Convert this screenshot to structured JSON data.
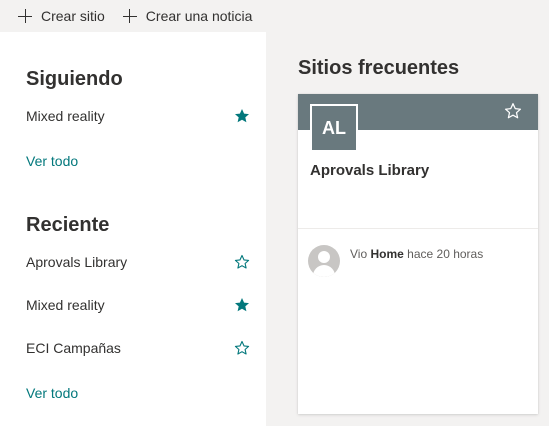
{
  "command_bar": {
    "create_site_label": "Crear sitio",
    "create_news_label": "Crear una noticia"
  },
  "following": {
    "title": "Siguiendo",
    "items": [
      {
        "label": "Mixed reality",
        "starred": true
      }
    ],
    "see_all_label": "Ver todo"
  },
  "recent": {
    "title": "Reciente",
    "items": [
      {
        "label": "Aprovals Library",
        "starred": false
      },
      {
        "label": "Mixed reality",
        "starred": true
      },
      {
        "label": "ECI Campañas",
        "starred": false
      }
    ],
    "see_all_label": "Ver todo"
  },
  "frequent": {
    "title": "Sitios frecuentes",
    "card": {
      "logo_initials": "AL",
      "site_name": "Aprovals Library",
      "activity_prefix": "Vio",
      "activity_page": "Home",
      "activity_suffix": "hace 20 horas"
    }
  },
  "colors": {
    "theme_accent": "#03787c",
    "site_logo": "#69797e",
    "right_pane_bg": "#f3f2f1"
  },
  "icons": {
    "add": "plus-icon",
    "star_filled": "star-filled-icon",
    "star_outline": "star-outline-icon",
    "person": "person-icon"
  }
}
